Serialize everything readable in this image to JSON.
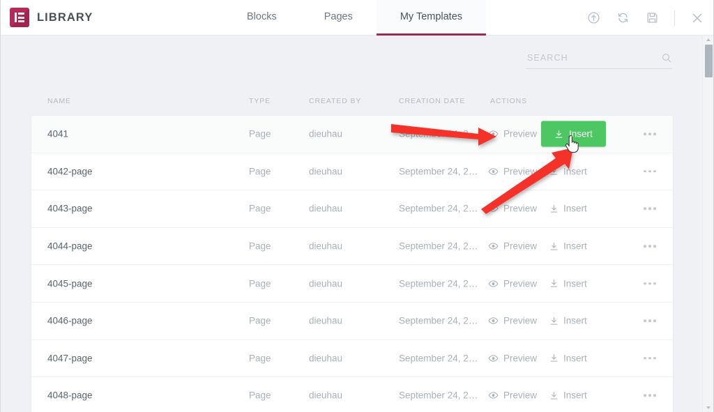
{
  "header": {
    "brand_title": "LIBRARY",
    "logo_icon": "elementor-logo-icon",
    "tabs": [
      {
        "label": "Blocks",
        "active": false
      },
      {
        "label": "Pages",
        "active": false
      },
      {
        "label": "My Templates",
        "active": true
      }
    ],
    "actions": [
      {
        "name": "upload-icon",
        "title": "Import Template"
      },
      {
        "name": "sync-icon",
        "title": "Sync Library"
      },
      {
        "name": "save-icon",
        "title": "Save"
      },
      {
        "name": "close-icon",
        "title": "Close"
      }
    ]
  },
  "search": {
    "placeholder": "SEARCH",
    "value": "",
    "icon": "search-icon"
  },
  "table": {
    "columns": [
      "NAME",
      "TYPE",
      "CREATED BY",
      "CREATION DATE",
      "ACTIONS"
    ],
    "action_labels": {
      "preview": "Preview",
      "insert": "Insert",
      "preview_icon": "eye-icon",
      "insert_icon": "download-icon",
      "more_icon": "ellipsis-icon"
    },
    "rows": [
      {
        "name": "4041",
        "type": "Page",
        "author": "dieuhau",
        "date": "September 24, 20…",
        "hovered": true,
        "insert_highlight": true
      },
      {
        "name": "4042-page",
        "type": "Page",
        "author": "dieuhau",
        "date": "September 24, 20…",
        "hovered": false,
        "insert_highlight": false
      },
      {
        "name": "4043-page",
        "type": "Page",
        "author": "dieuhau",
        "date": "September 24, 20…",
        "hovered": false,
        "insert_highlight": false
      },
      {
        "name": "4044-page",
        "type": "Page",
        "author": "dieuhau",
        "date": "September 24, 20…",
        "hovered": false,
        "insert_highlight": false
      },
      {
        "name": "4045-page",
        "type": "Page",
        "author": "dieuhau",
        "date": "September 24, 20…",
        "hovered": false,
        "insert_highlight": false
      },
      {
        "name": "4046-page",
        "type": "Page",
        "author": "dieuhau",
        "date": "September 24, 20…",
        "hovered": false,
        "insert_highlight": false
      },
      {
        "name": "4047-page",
        "type": "Page",
        "author": "dieuhau",
        "date": "September 24, 20…",
        "hovered": false,
        "insert_highlight": false
      },
      {
        "name": "4048-page",
        "type": "Page",
        "author": "dieuhau",
        "date": "September 24, 20…",
        "hovered": false,
        "insert_highlight": false
      }
    ]
  },
  "scrollbar": {
    "up_arrow_icon": "scroll-up-arrow-icon",
    "down_arrow_icon": "scroll-down-arrow-icon"
  },
  "annotations": [
    {
      "name": "arrow-to-preview",
      "color": "#f5322c"
    },
    {
      "name": "arrow-to-insert-button",
      "color": "#f5322c"
    }
  ],
  "colors": {
    "brand": "#b7295a",
    "tab_accent": "#9b2c52",
    "insert_green": "#4cc764",
    "annotation_red": "#f5322c",
    "page_bg": "#eff1f4"
  },
  "cursor": {
    "name": "hand-pointer-cursor"
  }
}
